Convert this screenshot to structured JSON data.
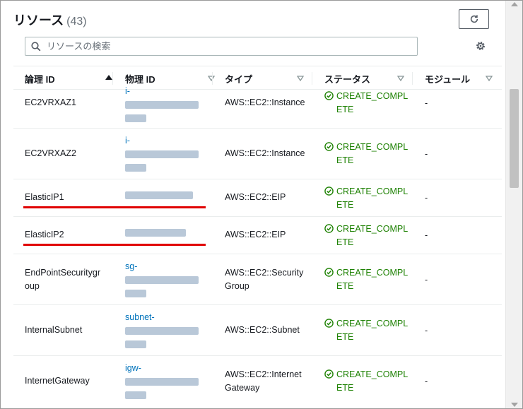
{
  "header": {
    "title": "リソース",
    "count": "(43)",
    "refresh_icon": "refresh-icon",
    "settings_icon": "gear-icon"
  },
  "search": {
    "placeholder": "リソースの検索",
    "value": ""
  },
  "table": {
    "columns": [
      {
        "label": "論理 ID",
        "sort": "ascending"
      },
      {
        "label": "物理 ID",
        "sort": "none"
      },
      {
        "label": "タイプ",
        "sort": "none"
      },
      {
        "label": "ステータス",
        "sort": "none"
      },
      {
        "label": "モジュール",
        "sort": "none"
      }
    ],
    "rows": [
      {
        "logical_id_l1": "EC2VRXAZ1",
        "logical_id_l2": "",
        "physical_id_prefix": "i-",
        "type_l1": "AWS::EC2::Instance",
        "type_l2": "",
        "status_l1": "CREATE_COMPL",
        "status_l2": "ETE",
        "module": "-"
      },
      {
        "logical_id_l1": "EC2VRXAZ2",
        "logical_id_l2": "",
        "physical_id_prefix": "i-",
        "type_l1": "AWS::EC2::Instance",
        "type_l2": "",
        "status_l1": "CREATE_COMPL",
        "status_l2": "ETE",
        "module": "-"
      },
      {
        "logical_id_l1": "ElasticIP1",
        "logical_id_l2": "",
        "physical_id_prefix": "",
        "type_l1": "AWS::EC2::EIP",
        "type_l2": "",
        "status_l1": "CREATE_COMPL",
        "status_l2": "ETE",
        "module": "-"
      },
      {
        "logical_id_l1": "ElasticIP2",
        "logical_id_l2": "",
        "physical_id_prefix": "",
        "type_l1": "AWS::EC2::EIP",
        "type_l2": "",
        "status_l1": "CREATE_COMPL",
        "status_l2": "ETE",
        "module": "-"
      },
      {
        "logical_id_l1": "EndPointSecuritygr",
        "logical_id_l2": "oup",
        "physical_id_prefix": "sg-",
        "type_l1": "AWS::EC2::Security",
        "type_l2": "Group",
        "status_l1": "CREATE_COMPL",
        "status_l2": "ETE",
        "module": "-"
      },
      {
        "logical_id_l1": "InternalSubnet",
        "logical_id_l2": "",
        "physical_id_prefix": "subnet-",
        "type_l1": "AWS::EC2::Subnet",
        "type_l2": "",
        "status_l1": "CREATE_COMPL",
        "status_l2": "ETE",
        "module": "-"
      },
      {
        "logical_id_l1": "InternetGateway",
        "logical_id_l2": "",
        "physical_id_prefix": "igw-",
        "type_l1": "AWS::EC2::Internet",
        "type_l2": "Gateway",
        "status_l1": "CREATE_COMPL",
        "status_l2": "ETE",
        "module": "-"
      }
    ]
  },
  "colors": {
    "link": "#0073bb",
    "success": "#1d8102",
    "highlight": "#e00000"
  }
}
